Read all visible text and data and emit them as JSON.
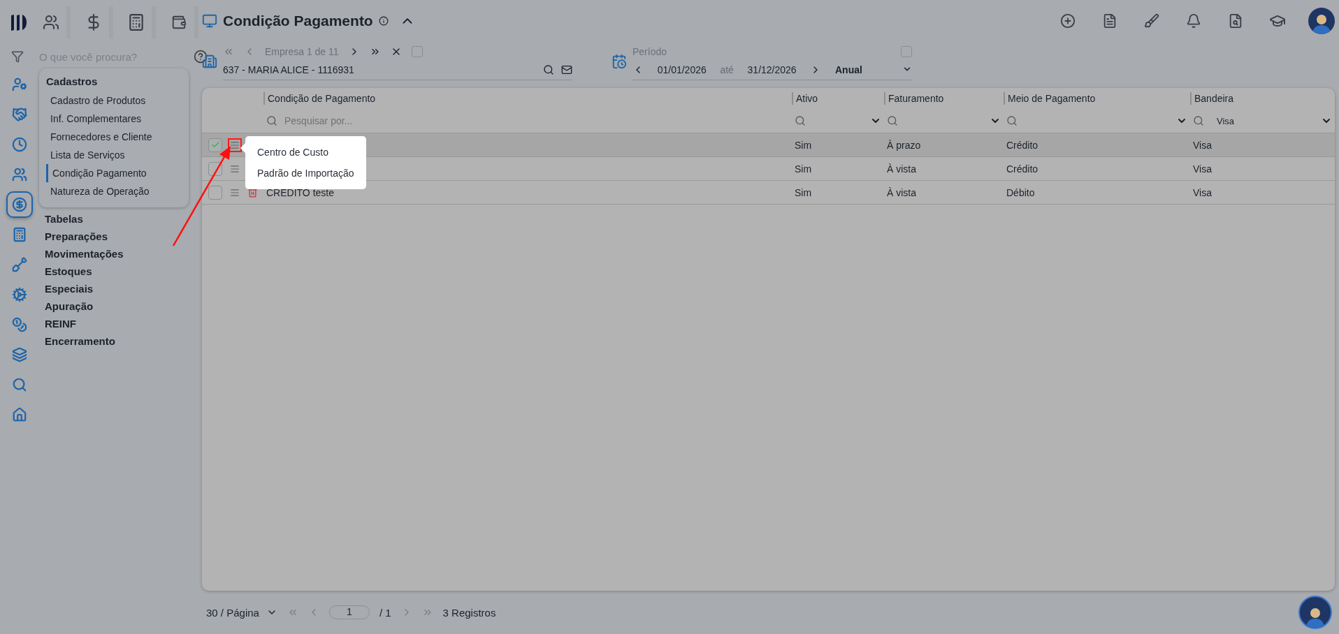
{
  "rail": [
    {
      "selected": false
    },
    {
      "selected": false
    },
    {
      "selected": false
    },
    {
      "selected": false
    },
    {
      "selected": true
    },
    {
      "selected": false
    },
    {
      "selected": false
    },
    {
      "selected": false
    },
    {
      "selected": false
    },
    {
      "selected": false
    },
    {
      "selected": false
    },
    {
      "selected": false
    }
  ],
  "search": {
    "placeholder": "O que você procura?"
  },
  "menu": [
    {
      "label": "Cadastros",
      "expanded": true,
      "items": [
        {
          "label": "Cadastro de Produtos",
          "selected": false
        },
        {
          "label": "Inf. Complementares",
          "selected": false
        },
        {
          "label": "Fornecedores e Cliente",
          "selected": false
        },
        {
          "label": "Lista de Serviços",
          "selected": false
        },
        {
          "label": "Condição Pagamento",
          "selected": true
        },
        {
          "label": "Natureza de Operação",
          "selected": false
        }
      ]
    },
    {
      "label": "Tabelas",
      "expanded": false
    },
    {
      "label": "Preparações",
      "expanded": false
    },
    {
      "label": "Movimentações",
      "expanded": false
    },
    {
      "label": "Estoques",
      "expanded": false
    },
    {
      "label": "Especiais",
      "expanded": false
    },
    {
      "label": "Apuração",
      "expanded": false
    },
    {
      "label": "REINF",
      "expanded": false
    },
    {
      "label": "Encerramento",
      "expanded": false
    }
  ],
  "page": {
    "title": "Condição Pagamento"
  },
  "company": {
    "pager": "Empresa 1 de 11",
    "value": "637 - MARIA ALICE - 1116931",
    "checked": false
  },
  "period": {
    "label": "Período",
    "start": "01/01/2026",
    "separator": "até",
    "end": "31/12/2026",
    "mode": "Anual",
    "checked": false
  },
  "table": {
    "columns": [
      {
        "label": "Condição de Pagamento",
        "filter": {
          "kind": "text",
          "placeholder": "Pesquisar por..."
        }
      },
      {
        "label": "Ativo",
        "filter": {
          "kind": "select"
        }
      },
      {
        "label": "Faturamento",
        "filter": {
          "kind": "select"
        }
      },
      {
        "label": "Meio de Pagamento",
        "filter": {
          "kind": "select"
        }
      },
      {
        "label": "Bandeira",
        "filter": {
          "kind": "select",
          "value": "Visa"
        }
      }
    ],
    "rows": [
      {
        "selected": true,
        "annotated": true,
        "cells": [
          "",
          "Sim",
          "À prazo",
          "Crédito",
          "Visa"
        ]
      },
      {
        "selected": false,
        "annotated": false,
        "cells": [
          "",
          "Sim",
          "À vista",
          "Crédito",
          "Visa"
        ]
      },
      {
        "selected": false,
        "annotated": false,
        "cells": [
          "CREDITO teste",
          "Sim",
          "À vista",
          "Débito",
          "Visa"
        ]
      }
    ]
  },
  "context_menu": {
    "items": [
      "Centro de Custo",
      "Padrão de Importação"
    ]
  },
  "pagination": {
    "page_size": "30 / Página",
    "page": "1",
    "total_pages": "/ 1",
    "records": "3 Registros"
  }
}
